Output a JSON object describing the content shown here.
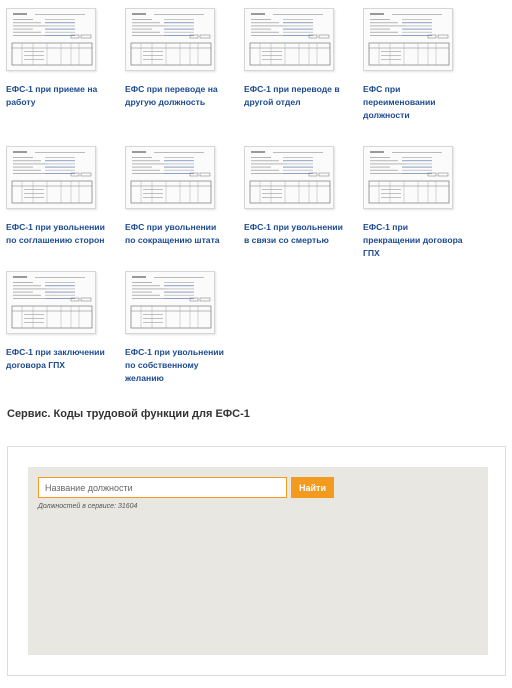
{
  "cards": [
    {
      "label": "ЕФС-1 при приеме на работу"
    },
    {
      "label": "ЕФС при переводе на другую должность"
    },
    {
      "label": "ЕФС-1 при переводе в другой отдел"
    },
    {
      "label": "ЕФС при переименовании должности"
    },
    {
      "label": "ЕФС-1 при увольнении по соглашению сторон"
    },
    {
      "label": "ЕФС при увольнении по сокращению штата"
    },
    {
      "label": "ЕФС-1 при увольнении в связи со смертью"
    },
    {
      "label": "ЕФС-1 при прекращении договора ГПХ"
    },
    {
      "label": "ЕФС-1 при заключении договора ГПХ"
    },
    {
      "label": "ЕФС-1 при увольнении по собственному желанию"
    }
  ],
  "service": {
    "title": "Сервис. Коды трудовой функции для ЕФС-1",
    "input_placeholder": "Название должности",
    "button_label": "Найти",
    "note": "Должностей в сервисе: 31604"
  },
  "colors": {
    "link": "#1c4a8f",
    "accent": "#f29b1f",
    "panel": "#e8e7e2"
  }
}
